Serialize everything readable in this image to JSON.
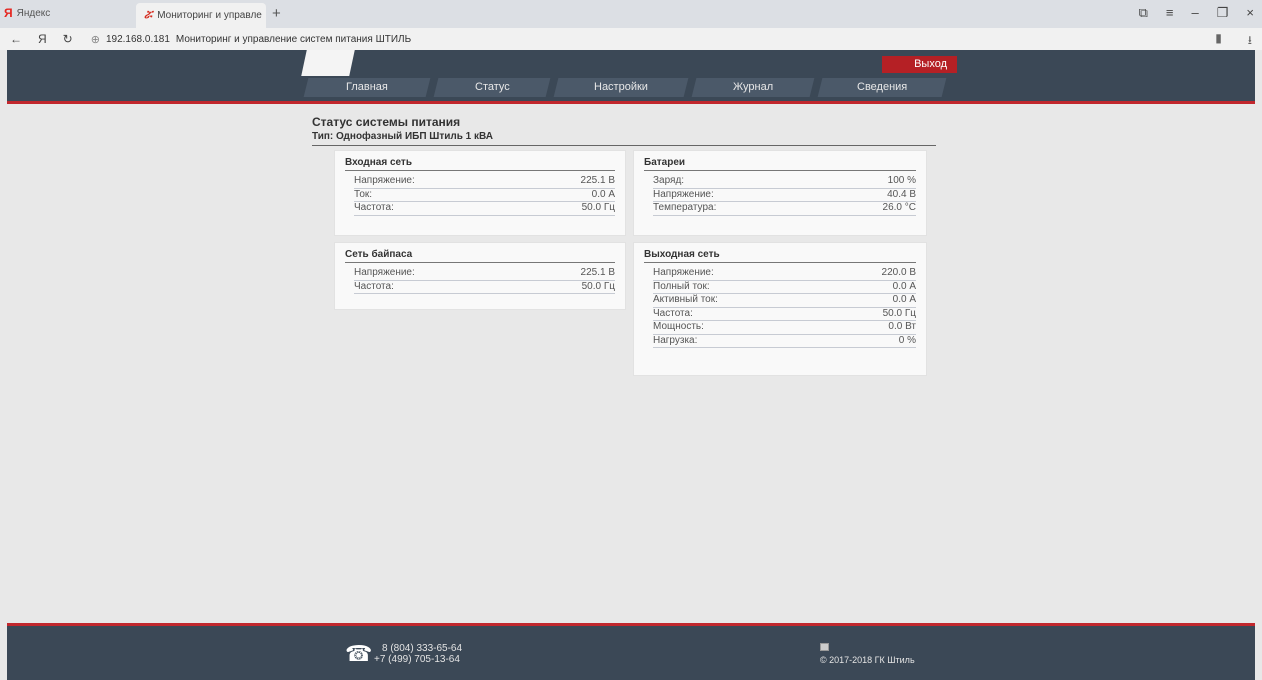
{
  "browser": {
    "tab_yandex_logo": "Я",
    "tab_yandex_label": "Яндекс",
    "active_tab_label": "Мониторинг и управле",
    "close_glyph": "✕",
    "new_tab_glyph": "+",
    "url": "192.168.0.181",
    "page_title": "Мониторинг и управление систем питания ШТИЛЬ"
  },
  "header": {
    "exit_label": "Выход",
    "menu": [
      {
        "label": "Главная"
      },
      {
        "label": "Статус"
      },
      {
        "label": "Настройки"
      },
      {
        "label": "Журнал"
      },
      {
        "label": "Сведения"
      }
    ]
  },
  "status": {
    "title": "Статус системы питания",
    "type": "Тип: Однофазный ИБП Штиль 1 кВА"
  },
  "panels": {
    "input": {
      "title": "Входная сеть",
      "rows": [
        {
          "label": "Напряжение:",
          "value": "225.1 В"
        },
        {
          "label": "Ток:",
          "value": "0.0 А"
        },
        {
          "label": "Частота:",
          "value": "50.0 Гц"
        }
      ]
    },
    "batteries": {
      "title": "Батареи",
      "rows": [
        {
          "label": "Заряд:",
          "value": "100 %"
        },
        {
          "label": "Напряжение:",
          "value": "40.4 В"
        },
        {
          "label": "Температура:",
          "value": "26.0 °C"
        }
      ]
    },
    "bypass": {
      "title": "Сеть байпаса",
      "rows": [
        {
          "label": "Напряжение:",
          "value": "225.1 В"
        },
        {
          "label": "Частота:",
          "value": "50.0 Гц"
        }
      ]
    },
    "output": {
      "title": "Выходная сеть",
      "rows": [
        {
          "label": "Напряжение:",
          "value": "220.0 В"
        },
        {
          "label": "Полный ток:",
          "value": "0.0 А"
        },
        {
          "label": "Активный ток:",
          "value": "0.0 А"
        },
        {
          "label": "Частота:",
          "value": "50.0 Гц"
        },
        {
          "label": "Мощность:",
          "value": "0.0 Вт"
        },
        {
          "label": "Нагрузка:",
          "value": "0 %"
        }
      ]
    }
  },
  "footer": {
    "phone1": "8 (804) 333-65-64",
    "phone2": "+7 (499) 705-13-64",
    "copyright": "© 2017-2018 ГК Штиль"
  },
  "colors": {
    "header_bg": "#3b4856",
    "accent_red": "#c1272d",
    "menu_bg": "#4b5969",
    "page_bg": "#e8e8e8"
  },
  "icons": [
    "back-arrow-icon",
    "yandex-icon",
    "reload-icon",
    "site-info-icon",
    "bookmark-icon",
    "download-icon",
    "phone-icon"
  ]
}
